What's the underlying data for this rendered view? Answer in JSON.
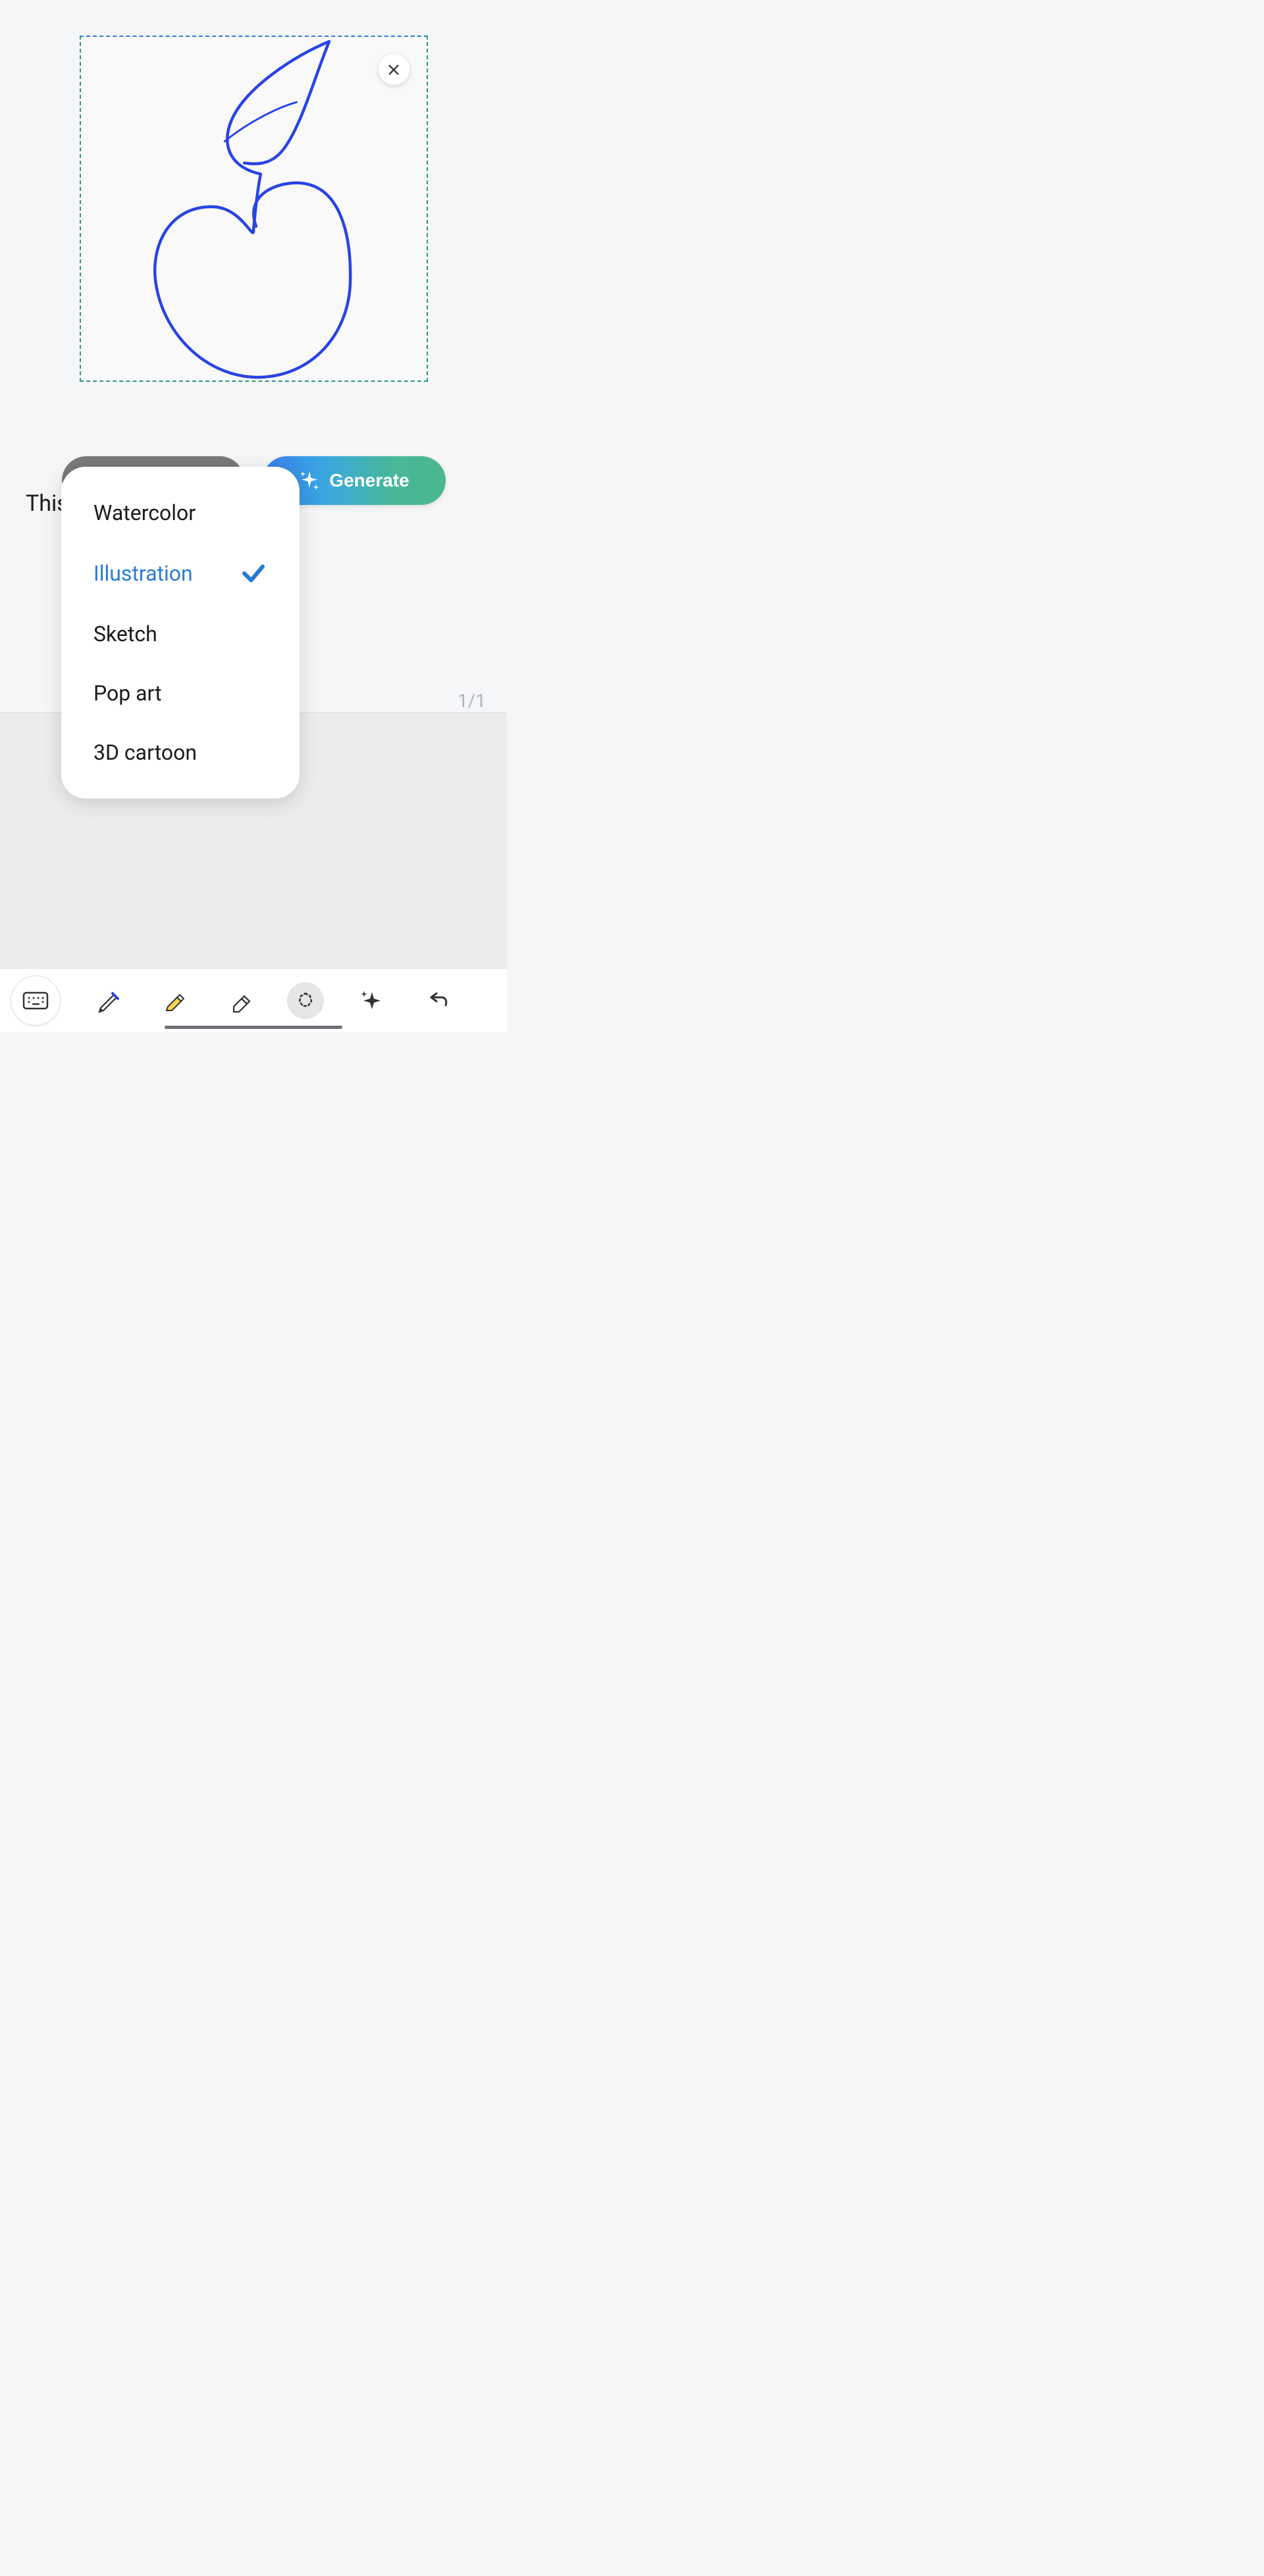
{
  "canvas": {
    "closeLabel": "Close",
    "sketchDescription": "apple-sketch"
  },
  "hiddenText": "This",
  "generateButton": {
    "label": "Generate"
  },
  "styleDropdown": {
    "options": [
      "Watercolor",
      "Illustration",
      "Sketch",
      "Pop art",
      "3D cartoon"
    ],
    "selectedIndex": 1
  },
  "pageCounter": "1/1",
  "toolbar": {
    "keyboard": "keyboard",
    "pen": "pen",
    "highlighter": "highlighter",
    "eraser": "eraser",
    "lasso": "lasso",
    "sparkle": "ai-sparkle",
    "undo": "undo"
  }
}
